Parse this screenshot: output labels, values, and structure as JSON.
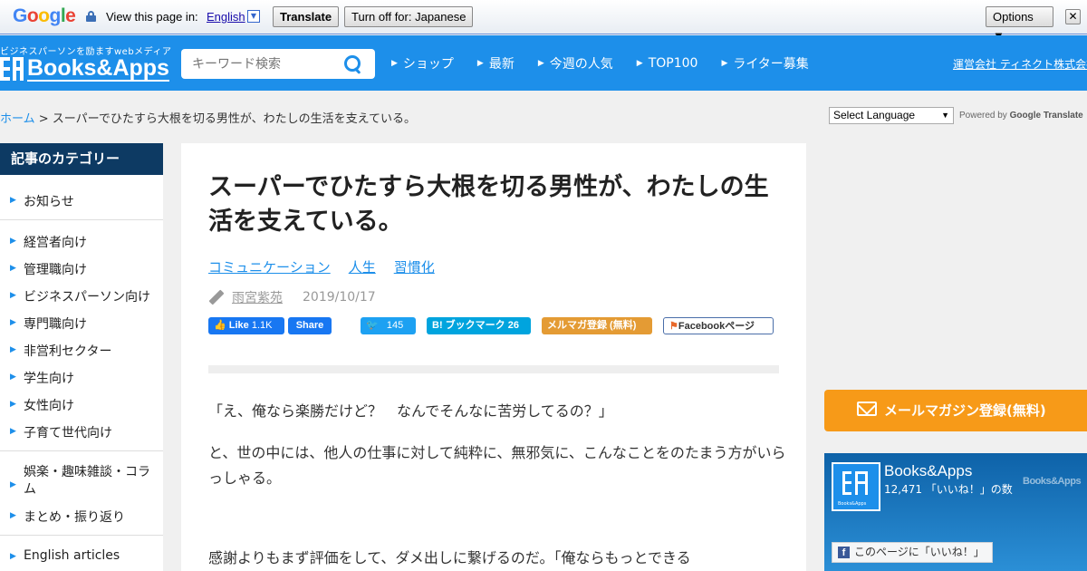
{
  "translate_bar": {
    "logo_letters": [
      {
        "ch": "G",
        "color": "#4285f4"
      },
      {
        "ch": "o",
        "color": "#ea4335"
      },
      {
        "ch": "o",
        "color": "#fbbc05"
      },
      {
        "ch": "g",
        "color": "#4285f4"
      },
      {
        "ch": "l",
        "color": "#34a853"
      },
      {
        "ch": "e",
        "color": "#ea4335"
      }
    ],
    "view_text": "View this page in:",
    "language": "English",
    "translate_label": "Translate",
    "turn_off_label": "Turn off for: Japanese",
    "options_label": "Options ▼",
    "close_label": "✕"
  },
  "header": {
    "tagline": "ビジネスパーソンを励ますwebメディア",
    "site_name": "Books&Apps",
    "search_placeholder": "キーワード検索",
    "nav": [
      "ショップ",
      "最新",
      "今週の人気",
      "TOP100",
      "ライター募集"
    ],
    "company_link": "運営会社 ティネクト株式会社"
  },
  "breadcrumb": {
    "home": "ホーム",
    "separator": " > ",
    "current": "スーパーでひたすら大根を切る男性が、わたしの生活を支えている。"
  },
  "translate_widget": {
    "select_label": "Select Language",
    "powered_by": "Powered by",
    "google": "Google",
    "translate": "Translate"
  },
  "sidebar": {
    "heading": "記事のカテゴリー",
    "items": [
      "お知らせ",
      "経営者向け",
      "管理職向け",
      "ビジネスパーソン向け",
      "専門職向け",
      "非営利セクター",
      "学生向け",
      "女性向け",
      "子育て世代向け",
      "娯楽・趣味雑談・コラム",
      "まとめ・振り返り",
      "English articles"
    ]
  },
  "article": {
    "title": "スーパーでひたすら大根を切る男性が、わたしの生活を支えている。",
    "tags": [
      "コミュニケーション",
      "人生",
      "習慣化"
    ],
    "author": "雨宮紫苑",
    "date": "2019/10/17",
    "social": {
      "fb_like": "Like",
      "fb_like_count": "1.1K",
      "fb_share": "Share",
      "tw_count": "145",
      "hatena_label": "ブックマーク",
      "hatena_count": "26",
      "mail_label": "メルマガ登録 (無料)",
      "fbpage_label": "Facebookページ"
    },
    "paragraphs": [
      "「え、俺なら楽勝だけど？　なんでそんなに苦労してるの？」",
      "と、世の中には、他人の仕事に対して純粋に、無邪気に、こんなことをのたまう方がいらっしゃる。",
      "感謝よりもまず評価をして、ダメ出しに繋げるのだ。「俺ならもっとできる"
    ]
  },
  "mailmag": {
    "label": "メールマガジン登録(無料)"
  },
  "fb_box": {
    "page_name": "Books&Apps",
    "like_count": "12,471 「いいね！」の数",
    "watermark": "Books&Apps",
    "like_button": "このページに「いいね！」"
  },
  "colors": {
    "header_blue": "#1d8fea",
    "sidebar_head": "#0d3a63",
    "mail_orange": "#f79a18"
  }
}
